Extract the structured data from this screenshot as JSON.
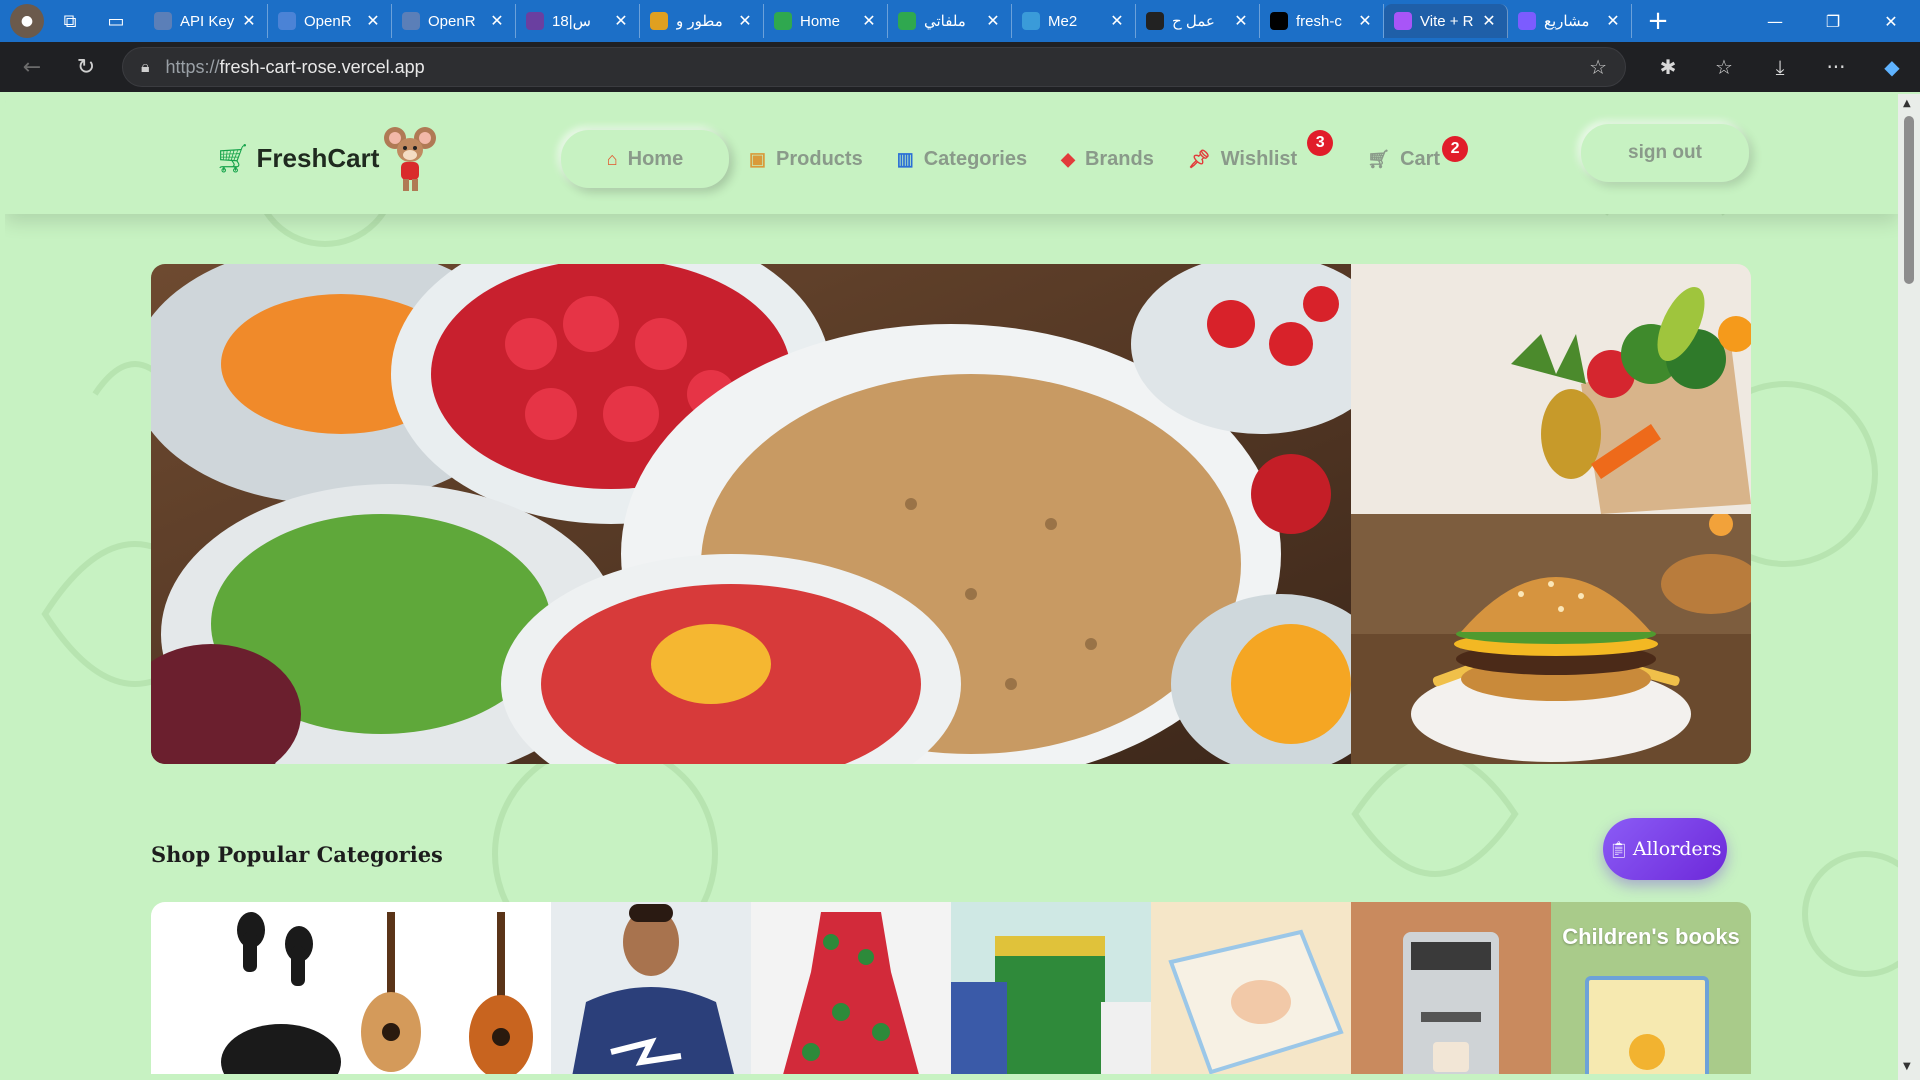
{
  "browser": {
    "tabs": [
      {
        "title": "API Key",
        "favicon": "api-icon",
        "color": "#5b7fb8"
      },
      {
        "title": "OpenR",
        "favicon": "openrouter-icon",
        "color": "#4b83d6"
      },
      {
        "title": "OpenR",
        "favicon": "openrouter-icon",
        "color": "#5b7fb8"
      },
      {
        "title": "س|18",
        "favicon": "video-icon",
        "color": "#6a3fa0"
      },
      {
        "title": "مطور و",
        "favicon": "badge-5-icon",
        "color": "#e0a020"
      },
      {
        "title": "Home",
        "favicon": "drive-icon",
        "color": "#2fa84f"
      },
      {
        "title": "ملفاتي",
        "favicon": "drive-icon",
        "color": "#2fa84f"
      },
      {
        "title": "Me2",
        "favicon": "telegram-icon",
        "color": "#3a9bd9"
      },
      {
        "title": "عمل ح",
        "favicon": "chatgpt-icon",
        "color": "#222222"
      },
      {
        "title": "fresh-c",
        "favicon": "vercel-icon",
        "color": "#000000"
      },
      {
        "title": "Vite + R",
        "favicon": "vite-icon",
        "color": "#a855f7"
      },
      {
        "title": "مشاريع",
        "favicon": "project-icon",
        "color": "#7c5cff"
      }
    ],
    "active_tab_index": 10,
    "address": {
      "prefix": "https://",
      "host": "fresh-cart-rose.vercel.app"
    }
  },
  "site": {
    "brand": "FreshCart",
    "nav": {
      "home": "Home",
      "products": "Products",
      "categories": "Categories",
      "brands": "Brands",
      "wishlist": "Wishlist",
      "cart": "Cart"
    },
    "wishlist_count": "3",
    "cart_count": "2",
    "signout": "sign out"
  },
  "main": {
    "section_title": "Shop Popular Categories",
    "allorders_label": "Allorders",
    "categories": [
      {
        "label": "",
        "name": "earbuds",
        "bg": "#ffffff"
      },
      {
        "label": "",
        "name": "guitars",
        "bg": "#ffffff"
      },
      {
        "label": "",
        "name": "hoodie",
        "bg": "#e7ecef"
      },
      {
        "label": "",
        "name": "dress",
        "bg": "#f3f3f3"
      },
      {
        "label": "",
        "name": "supermarket",
        "bg": "#cfe8e4"
      },
      {
        "label": "",
        "name": "baby-diapers",
        "bg": "#f5e6c8"
      },
      {
        "label": "",
        "name": "coffee-machine",
        "bg": "#c98a5e"
      },
      {
        "label": "Children's books",
        "name": "books",
        "bg": "#a9cb8a"
      }
    ]
  },
  "colors": {
    "page_bg": "#c7f2c2",
    "brand_green": "#15a34a",
    "badge_red": "#e11d2a",
    "allorders_purple": "#7c3aed",
    "tab_bar": "#1c6fc7"
  }
}
